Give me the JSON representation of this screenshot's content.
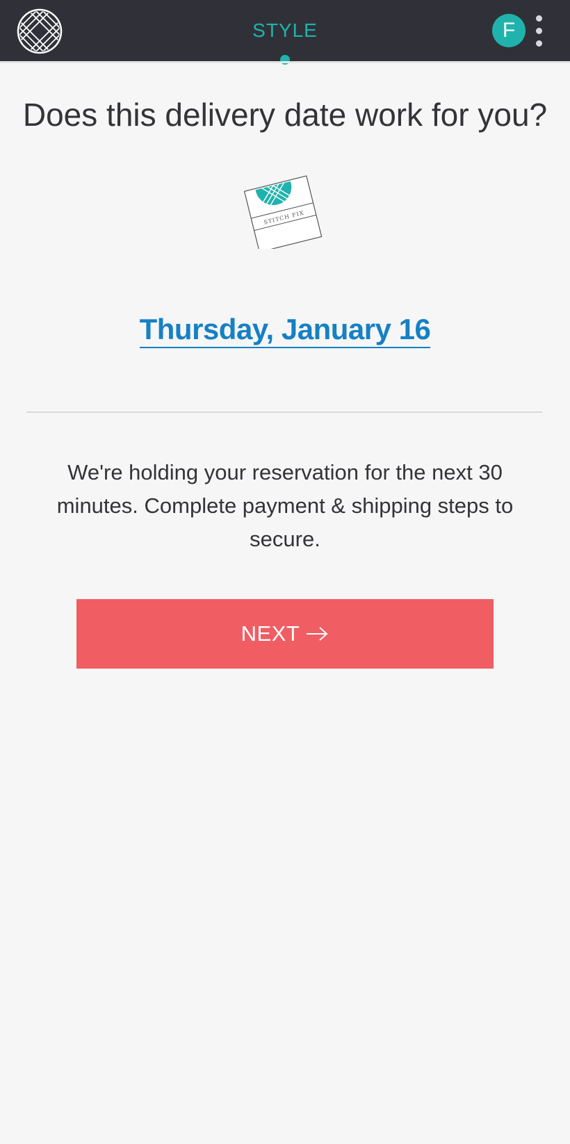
{
  "header": {
    "logo_icon": "stitch-fix-logo-icon",
    "tab_label": "STYLE",
    "avatar_initial": "F",
    "menu_icon": "kebab-menu-icon",
    "accent_color": "#20b3ad",
    "bar_color": "#303138"
  },
  "main": {
    "title": "Does this delivery date work for you?",
    "box_illustration_icon": "shipping-box-icon",
    "box_text": "STITCH FIX",
    "delivery_date": "Thursday, January 16",
    "date_link_color": "#1680c4",
    "message": "We're holding your reservation for the next 30 minutes. Complete payment & shipping steps to secure.",
    "next_button_label": "NEXT",
    "next_button_icon": "arrow-right-icon",
    "button_color": "#f05d63"
  }
}
